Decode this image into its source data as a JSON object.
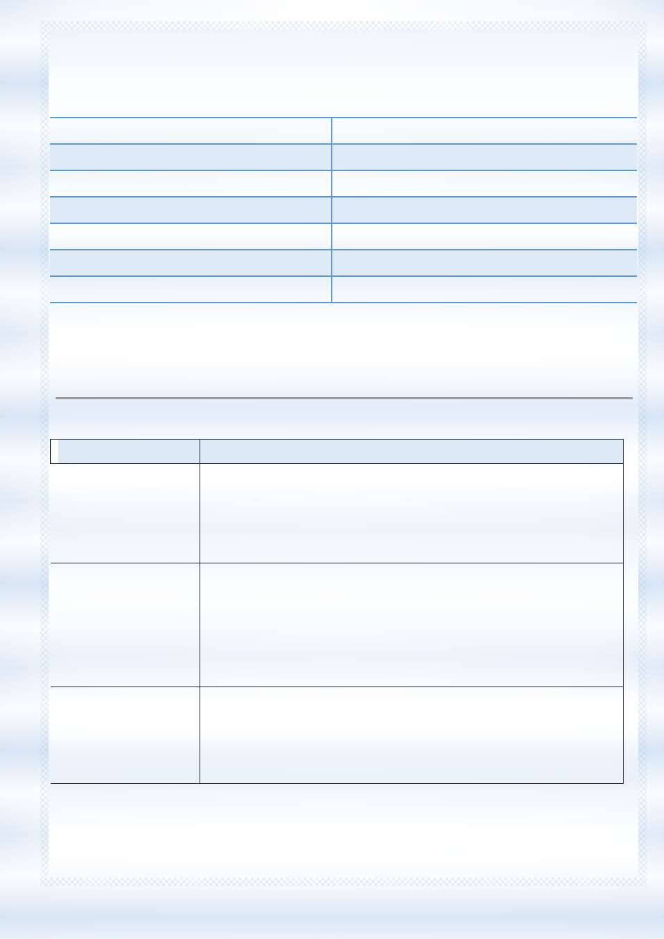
{
  "top_table": {
    "rows": [
      {
        "left": "",
        "right": ""
      },
      {
        "left": "",
        "right": ""
      },
      {
        "left": "",
        "right": ""
      },
      {
        "left": "",
        "right": ""
      },
      {
        "left": "",
        "right": ""
      },
      {
        "left": "",
        "right": ""
      },
      {
        "left": "",
        "right": ""
      }
    ]
  },
  "bottom_table": {
    "header": {
      "col1": "",
      "col2": ""
    },
    "rows": [
      {
        "col1": "",
        "col2": ""
      },
      {
        "col1": "",
        "col2": ""
      },
      {
        "col1": "",
        "col2": ""
      }
    ]
  },
  "colors": {
    "table_border_blue": "#5b9bd5",
    "row_shade": "#deeaf6",
    "header_shade": "#dde8f5",
    "rule_gray": "#9a9a9a"
  }
}
